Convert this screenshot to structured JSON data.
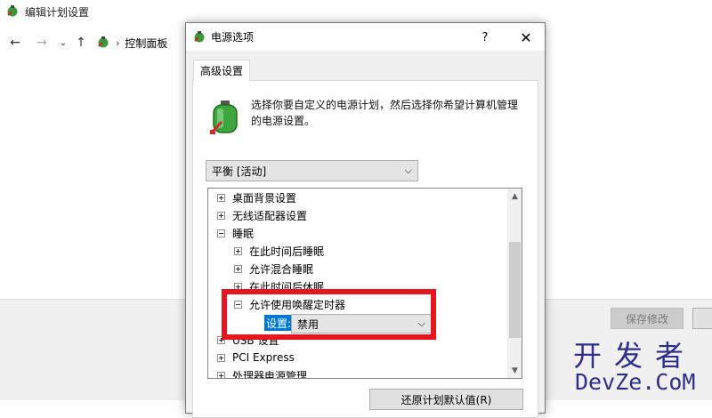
{
  "background_window": {
    "title": "编辑计划设置",
    "nav": {
      "back_icon": "arrow-left-icon",
      "forward_icon": "arrow-right-icon",
      "recent_icon": "chevron-down-icon",
      "up_icon": "arrow-up-icon"
    },
    "breadcrumb": [
      "控制面板"
    ],
    "footer": {
      "save_label": "保存修改"
    }
  },
  "dialog": {
    "title": "电源选项",
    "help_label": "?",
    "close_label": "✕",
    "tab_label": "高级设置",
    "description": "选择你要自定义的电源计划，然后选择你希望计算机管理的电源设置。",
    "plan_select": {
      "value": "平衡 [活动]"
    },
    "tree": [
      {
        "label": "桌面背景设置",
        "expander": "plus",
        "level": 0
      },
      {
        "label": "无线适配器设置",
        "expander": "plus",
        "level": 0
      },
      {
        "label": "睡眠",
        "expander": "minus",
        "level": 0
      },
      {
        "label": "在此时间后睡眠",
        "expander": "plus",
        "level": 1
      },
      {
        "label": "允许混合睡眠",
        "expander": "plus",
        "level": 1
      },
      {
        "label": "在此时间后休眠",
        "expander": "plus",
        "level": 1
      },
      {
        "label": "允许使用唤醒定时器",
        "expander": "minus",
        "level": 1
      },
      {
        "label": "USB 设置",
        "expander": "plus",
        "level": 0
      },
      {
        "label": "PCI Express",
        "expander": "plus",
        "level": 0
      },
      {
        "label": "处理器电源管理",
        "expander": "plus",
        "level": 0
      }
    ],
    "setting": {
      "label": "设置:",
      "value": "禁用"
    },
    "restore_label": "还原计划默认值(R)"
  },
  "watermark": {
    "line1": "开发者",
    "line2": "DevZe.CoM"
  },
  "colors": {
    "highlight": "#e8141f",
    "selection": "#0078d7",
    "watermark": "#2e2e8c"
  }
}
